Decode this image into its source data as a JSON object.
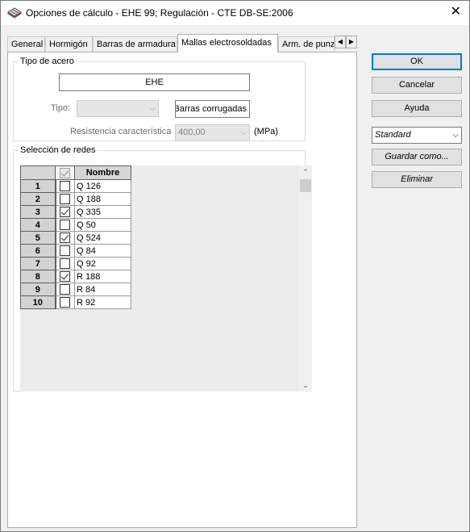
{
  "window": {
    "title": "Opciones de cálculo - EHE 99;  Regulación - CTE DB-SE:2006",
    "close_glyph": "✕"
  },
  "tabs": [
    {
      "label": "General"
    },
    {
      "label": "Hormigón"
    },
    {
      "label": "Barras de armadura"
    },
    {
      "label": "Mallas electrosoldadas",
      "active": true
    },
    {
      "label": "Arm. de punzonamiento"
    }
  ],
  "tipo_acero": {
    "legend": "Tipo de acero",
    "value": "EHE",
    "tipo_label": "Tipo:",
    "tipo_value": "",
    "barras_value": "Barras corrugadas",
    "resistencia_label": "Resistencia característica",
    "resistencia_value": "400,00",
    "unit": "(MPa)"
  },
  "seleccion": {
    "legend": "Selección de redes",
    "header_name": "Nombre",
    "rows": [
      {
        "num": "1",
        "name": "Q 126",
        "checked": false
      },
      {
        "num": "2",
        "name": "Q 188",
        "checked": false
      },
      {
        "num": "3",
        "name": "Q 335",
        "checked": true
      },
      {
        "num": "4",
        "name": "Q 50",
        "checked": false
      },
      {
        "num": "5",
        "name": "Q 524",
        "checked": true
      },
      {
        "num": "6",
        "name": "Q 84",
        "checked": false
      },
      {
        "num": "7",
        "name": "Q 92",
        "checked": false
      },
      {
        "num": "8",
        "name": "R 188",
        "checked": true
      },
      {
        "num": "9",
        "name": "R 84",
        "checked": false
      },
      {
        "num": "10",
        "name": "R 92",
        "checked": false
      }
    ]
  },
  "buttons": {
    "ok": "OK",
    "cancel": "Cancelar",
    "help": "Ayuda",
    "profile_select": "Standard",
    "save_as": "Guardar como...",
    "delete": "Eliminar"
  }
}
